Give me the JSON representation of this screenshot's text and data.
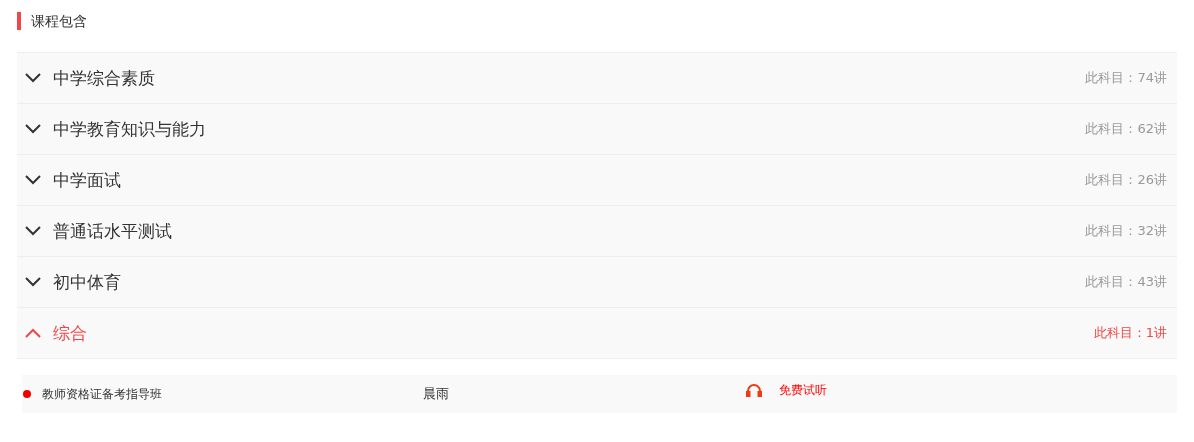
{
  "section_title": "课程包含",
  "subjects": [
    {
      "name": "中学综合素质",
      "count": "此科目：74讲",
      "expanded": false
    },
    {
      "name": "中学教育知识与能力",
      "count": "此科目：62讲",
      "expanded": false
    },
    {
      "name": "中学面试",
      "count": "此科目：26讲",
      "expanded": false
    },
    {
      "name": "普通话水平测试",
      "count": "此科目：32讲",
      "expanded": false
    },
    {
      "name": "初中体育",
      "count": "此科目：43讲",
      "expanded": false
    },
    {
      "name": "综合",
      "count": "此科目：1讲",
      "expanded": true,
      "lessons": [
        {
          "title": "教师资格证备考指导班",
          "teacher": "晨雨",
          "action": "免费试听"
        }
      ]
    }
  ]
}
